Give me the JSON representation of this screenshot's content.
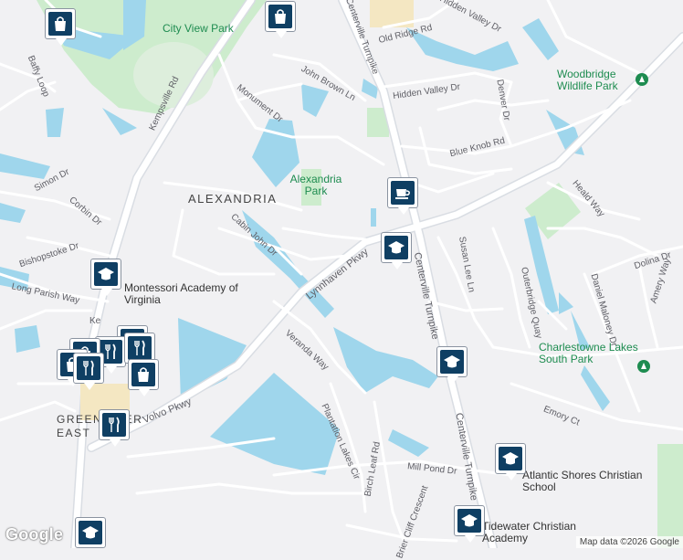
{
  "map": {
    "area_label": "ALEXANDRIA",
    "parks": {
      "city_view": "City View Park",
      "alexandria": "Alexandria Park",
      "woodbridge": "Woodbridge Wildlife Park",
      "charlestowne": "Charlestowne Lakes South Park"
    },
    "schools": {
      "montessori": "Montessori Academy of Virginia",
      "atlantic_shores": "Atlantic Shores Christian School",
      "tidewater": "Tidewater Christian Academy"
    },
    "greenbrier_label": "GREENBRIER EAST",
    "streets": {
      "baffy": "Baffy Loop",
      "kempsville": "Kempsville Rd",
      "kempsville_short": "Ke",
      "monument": "Monument Dr",
      "john_brown": "John Brown Ln",
      "centerville_top": "Centerville Turnpike",
      "old_ridge": "Old Ridge Rd",
      "hidden_valley_dr_top": "Hidden Valley Dr",
      "hidden_valley_dr": "Hidden Valley Dr",
      "denver": "Denver Dr",
      "blue_knob": "Blue Knob Rd",
      "simon": "Simon Dr",
      "corbin": "Corbin Dr",
      "cabin_john": "Cabin John Dr",
      "bishopstoke": "Bishopstoke Dr",
      "long_parish": "Long Parish Way",
      "lynnhaven": "Lynnhaven Pkwy",
      "heald": "Heald Way",
      "susan_lee": "Susan Lee Ln",
      "outerbridge": "Outerbridge Quay",
      "dolina": "Dolina Dr",
      "daniel_maloney": "Daniel Maloney Dr",
      "amery": "Amery Way",
      "centerville_mid": "Centerville Turnpike",
      "veranda": "Veranda Way",
      "volvo": "Volvo Pkwy",
      "plantation_lakes": "Plantation Lakes Cir",
      "birch_leaf": "Birch Leaf Rd",
      "mill_pond": "Mill Pond Dr",
      "emory": "Emory Ct",
      "brier_cliff": "Brier Cliff Crescent",
      "centerville_low": "Centerville Turnpike"
    },
    "pins": {
      "shopping": "shopping-bag-icon",
      "school": "graduation-cap-icon",
      "cafe": "coffee-cup-icon",
      "restaurant": "fork-knife-icon"
    },
    "colors": {
      "water": "#9fd6ec",
      "park": "#cdeccd",
      "road": "#ffffff",
      "pin": "#0f3f63",
      "park_text": "#1e8c50"
    }
  },
  "branding": {
    "logo": "Google",
    "attribution": "Map data ©2026 Google"
  }
}
